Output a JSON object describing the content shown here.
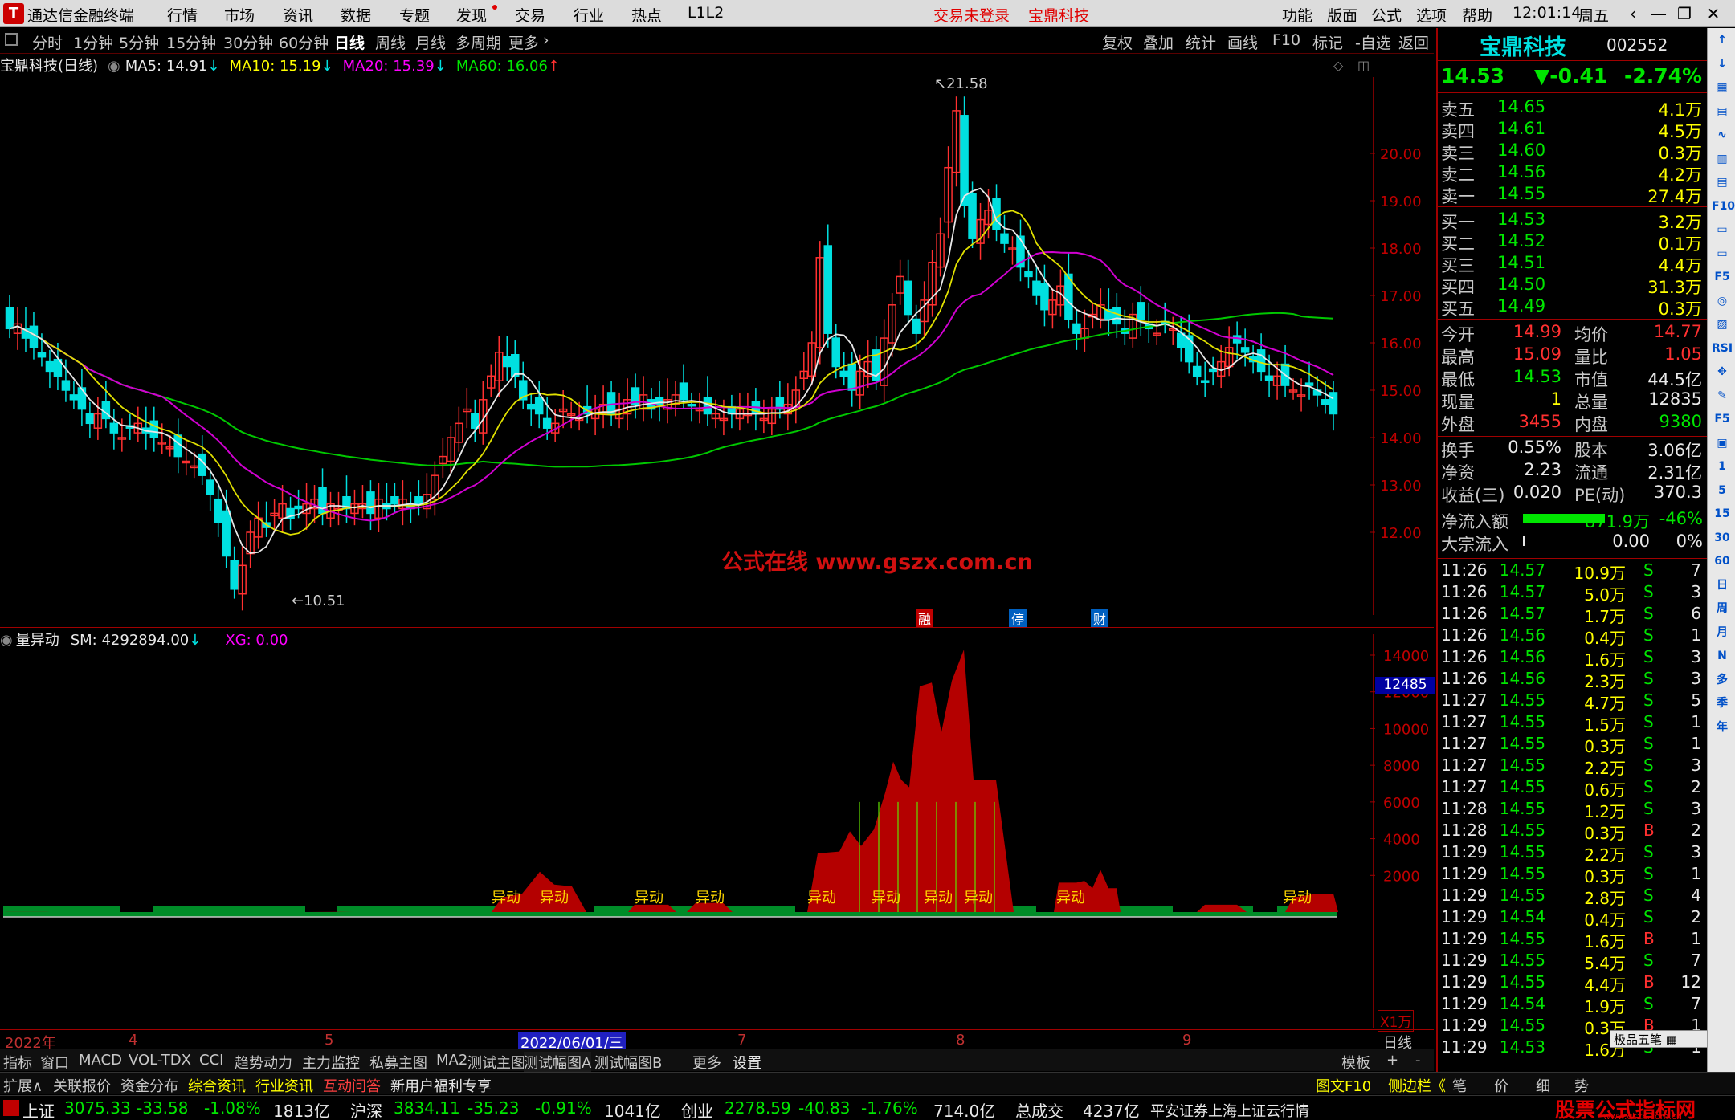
{
  "menubar": {
    "title": "通达信金融终端",
    "items": [
      "行情",
      "市场",
      "资讯",
      "数据",
      "专题",
      "发现",
      "交易",
      "行业",
      "热点",
      "L1L2"
    ],
    "center_red": [
      "交易未登录",
      "宝鼎科技"
    ],
    "right_items": [
      "功能",
      "版面",
      "公式",
      "选项",
      "帮助"
    ],
    "time": "12:01:14",
    "weekday": "周五"
  },
  "periodbar": {
    "items": [
      "分时",
      "1分钟",
      "5分钟",
      "15分钟",
      "30分钟",
      "60分钟",
      "日线",
      "周线",
      "月线",
      "多周期",
      "更多"
    ],
    "selected": "日线",
    "tools": [
      "复权",
      "叠加",
      "统计",
      "画线",
      "F10",
      "标记",
      "-自选",
      "返回"
    ]
  },
  "legend": {
    "name": "宝鼎科技(日线)",
    "ma5": "MA5: 14.91",
    "ma10": "MA10: 15.19",
    "ma20": "MA20: 15.39",
    "ma60": "MA60: 16.06",
    "colors": {
      "ma5": "#e8e8e8",
      "ma10": "#ffff00",
      "ma20": "#ff00ff",
      "ma60": "#00e600"
    }
  },
  "mainchart": {
    "price_ticks": [
      "20.00",
      "19.00",
      "18.00",
      "17.00",
      "16.00",
      "15.00",
      "14.00",
      "13.00",
      "12.00"
    ],
    "high_label": "21.58",
    "low_label": "10.51",
    "watermark": "公式在线 www.gszx.com.cn",
    "markers": [
      "融",
      "停",
      "财"
    ]
  },
  "sublegend": {
    "name": "量异动",
    "sm": "SM: 4292894.00",
    "xg": "XG: 0.00"
  },
  "subchart": {
    "ticks": [
      "14000",
      "12000",
      "10000",
      "8000",
      "6000",
      "4000",
      "2000"
    ],
    "current": "12485",
    "unit": "X1万",
    "signal_label": "异动"
  },
  "xaxis": {
    "labels": [
      "2022年",
      "4",
      "5",
      "2022/06/01/三",
      "7",
      "8",
      "9"
    ],
    "period": "日线"
  },
  "indtabs": [
    "指标",
    "窗口",
    "MACD",
    "VOL-TDX",
    "CCI",
    "趋势动力",
    "主力监控",
    "私募主图",
    "MA2",
    "测试主图",
    "测试幅图A",
    "测试幅图B",
    "更多",
    "设置"
  ],
  "indtabs_right": [
    "模板",
    "+",
    "-"
  ],
  "exttabs": [
    "扩展∧",
    "关联报价",
    "资金分布",
    "综合资讯",
    "行业资讯",
    "互动问答",
    "新用户福利专享"
  ],
  "exttabs_right": [
    "图文F10",
    "侧边栏《",
    "笔",
    "价",
    "细",
    "势"
  ],
  "statusbar": {
    "sh_name": "上证",
    "sh_val": "3075.33",
    "sh_chg": "-33.58",
    "sh_pct": "-1.08%",
    "sh_amt": "1813亿",
    "hs_name": "沪深",
    "hs_val": "3834.11",
    "hs_chg": "-35.23",
    "hs_pct": "-0.91%",
    "hs_amt": "1041亿",
    "cy_name": "创业",
    "cy_val": "2278.59",
    "cy_chg": "-40.83",
    "cy_pct": "-1.76%",
    "cy_amt": "714.0亿",
    "total_name": "总成交",
    "total_amt": "4237亿",
    "broker": "平安证券上海上证云行情",
    "brand": "股票公式指标网",
    "brand_url": "www.gszx.com.cn"
  },
  "quote": {
    "name": "宝鼎科技",
    "code": "002552",
    "price": "14.53",
    "change": "▼-0.41",
    "pct": "-2.74%",
    "asks": [
      {
        "label": "卖五",
        "price": "14.65",
        "vol": "4.1万"
      },
      {
        "label": "卖四",
        "price": "14.61",
        "vol": "4.5万"
      },
      {
        "label": "卖三",
        "price": "14.60",
        "vol": "0.3万"
      },
      {
        "label": "卖二",
        "price": "14.56",
        "vol": "4.2万"
      },
      {
        "label": "卖一",
        "price": "14.55",
        "vol": "27.4万"
      }
    ],
    "bids": [
      {
        "label": "买一",
        "price": "14.53",
        "vol": "3.2万"
      },
      {
        "label": "买二",
        "price": "14.52",
        "vol": "0.1万"
      },
      {
        "label": "买三",
        "price": "14.51",
        "vol": "4.4万"
      },
      {
        "label": "买四",
        "price": "14.50",
        "vol": "31.3万"
      },
      {
        "label": "买五",
        "price": "14.49",
        "vol": "0.3万"
      }
    ],
    "stats": [
      {
        "l1": "今开",
        "v1": "14.99",
        "l2": "均价",
        "v2": "14.77"
      },
      {
        "l1": "最高",
        "v1": "15.09",
        "l2": "量比",
        "v2": "1.05"
      },
      {
        "l1": "最低",
        "v1": "14.53",
        "l2": "市值",
        "v2": "44.5亿"
      },
      {
        "l1": "现量",
        "v1": "1",
        "l2": "总量",
        "v2": "12835"
      },
      {
        "l1": "外盘",
        "v1": "3455",
        "l2": "内盘",
        "v2": "9380"
      }
    ],
    "stats2": [
      {
        "l1": "换手",
        "v1": "0.55%",
        "l2": "股本",
        "v2": "3.06亿"
      },
      {
        "l1": "净资",
        "v1": "2.23",
        "l2": "流通",
        "v2": "2.31亿"
      },
      {
        "l1": "收益(三)",
        "v1": "0.020",
        "l2": "PE(动)",
        "v2": "370.3"
      }
    ],
    "flow": [
      {
        "label": "净流入额",
        "val": "-871.9万",
        "pct": "-46%"
      },
      {
        "label": "大宗流入",
        "val": "0.00",
        "pct": "0%"
      }
    ],
    "ticks": [
      {
        "t": "11:26",
        "p": "14.57",
        "v": "10.9万",
        "s": "S",
        "n": "7"
      },
      {
        "t": "11:26",
        "p": "14.57",
        "v": "5.0万",
        "s": "S",
        "n": "3"
      },
      {
        "t": "11:26",
        "p": "14.57",
        "v": "1.7万",
        "s": "S",
        "n": "6"
      },
      {
        "t": "11:26",
        "p": "14.56",
        "v": "0.4万",
        "s": "S",
        "n": "1"
      },
      {
        "t": "11:26",
        "p": "14.56",
        "v": "1.6万",
        "s": "S",
        "n": "3"
      },
      {
        "t": "11:26",
        "p": "14.56",
        "v": "2.3万",
        "s": "S",
        "n": "3"
      },
      {
        "t": "11:27",
        "p": "14.55",
        "v": "4.7万",
        "s": "S",
        "n": "5"
      },
      {
        "t": "11:27",
        "p": "14.55",
        "v": "1.5万",
        "s": "S",
        "n": "1"
      },
      {
        "t": "11:27",
        "p": "14.55",
        "v": "0.3万",
        "s": "S",
        "n": "1"
      },
      {
        "t": "11:27",
        "p": "14.55",
        "v": "2.2万",
        "s": "S",
        "n": "3"
      },
      {
        "t": "11:27",
        "p": "14.55",
        "v": "0.6万",
        "s": "S",
        "n": "2"
      },
      {
        "t": "11:28",
        "p": "14.55",
        "v": "1.2万",
        "s": "S",
        "n": "3"
      },
      {
        "t": "11:28",
        "p": "14.55",
        "v": "0.3万",
        "s": "B",
        "n": "2"
      },
      {
        "t": "11:29",
        "p": "14.55",
        "v": "2.2万",
        "s": "S",
        "n": "3"
      },
      {
        "t": "11:29",
        "p": "14.55",
        "v": "0.3万",
        "s": "S",
        "n": "1"
      },
      {
        "t": "11:29",
        "p": "14.55",
        "v": "2.8万",
        "s": "S",
        "n": "4"
      },
      {
        "t": "11:29",
        "p": "14.54",
        "v": "0.4万",
        "s": "S",
        "n": "2"
      },
      {
        "t": "11:29",
        "p": "14.55",
        "v": "1.6万",
        "s": "B",
        "n": "1"
      },
      {
        "t": "11:29",
        "p": "14.55",
        "v": "5.4万",
        "s": "S",
        "n": "7"
      },
      {
        "t": "11:29",
        "p": "14.55",
        "v": "4.4万",
        "s": "B",
        "n": "12"
      },
      {
        "t": "11:29",
        "p": "14.54",
        "v": "1.9万",
        "s": "S",
        "n": "7"
      },
      {
        "t": "11:29",
        "p": "14.55",
        "v": "0.3万",
        "s": "B",
        "n": "1"
      },
      {
        "t": "11:29",
        "p": "14.53",
        "v": "1.6万",
        "s": "S",
        "n": "1"
      }
    ],
    "popup": "极品五笔"
  },
  "toolstrip": [
    "↑",
    "↓",
    "▦",
    "▤",
    "∿",
    "▥",
    "▤",
    "F10",
    "▭",
    "▭",
    "F5",
    "◎",
    "▨",
    "RSI",
    "✥",
    "✎",
    "F5",
    "▣",
    "1",
    "5",
    "15",
    "30",
    "60",
    "日",
    "周",
    "月",
    "N",
    "多",
    "季",
    "年"
  ]
}
